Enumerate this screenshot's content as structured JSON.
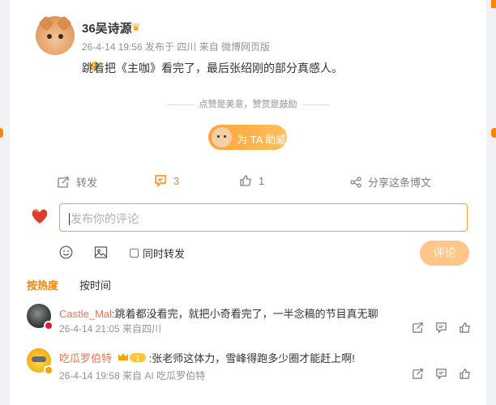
{
  "post": {
    "username": "36吴诗源",
    "meta": "26-4-14 19:56 发布于 四川 来自 微博网页版",
    "text": "跳着把《主咖》看完了，最后张绍刚的部分真感人。"
  },
  "tip": {
    "divider_text": "点赞是美意，赞赏是鼓励",
    "button_label": "为 TA 助威"
  },
  "actions": {
    "repost_label": "转发",
    "comment_count": "3",
    "like_count": "1",
    "share_label": "分享这条博文"
  },
  "compose": {
    "placeholder": "发布你的评论",
    "repost_checkbox_label": "同时转发",
    "submit_label": "评论"
  },
  "sort": {
    "hot": "按热度",
    "time": "按时间"
  },
  "comments": [
    {
      "name": "Castle_Mal",
      "text": ":跳着都没看完，就把小奇看完了，一半念稿的节目真无聊",
      "meta": "26-4-14 21:05 来自四川"
    },
    {
      "name": "吃瓜罗伯特",
      "badge": "1",
      "text": ":张老师这体力，雪峰得跑多少圈才能赶上啊!",
      "meta": "26-4-14 19:58 来自 AI 吃瓜罗伯特"
    }
  ],
  "colors": {
    "accent": "#ff8200",
    "link_name": "#eb7350",
    "muted": "#939393"
  }
}
